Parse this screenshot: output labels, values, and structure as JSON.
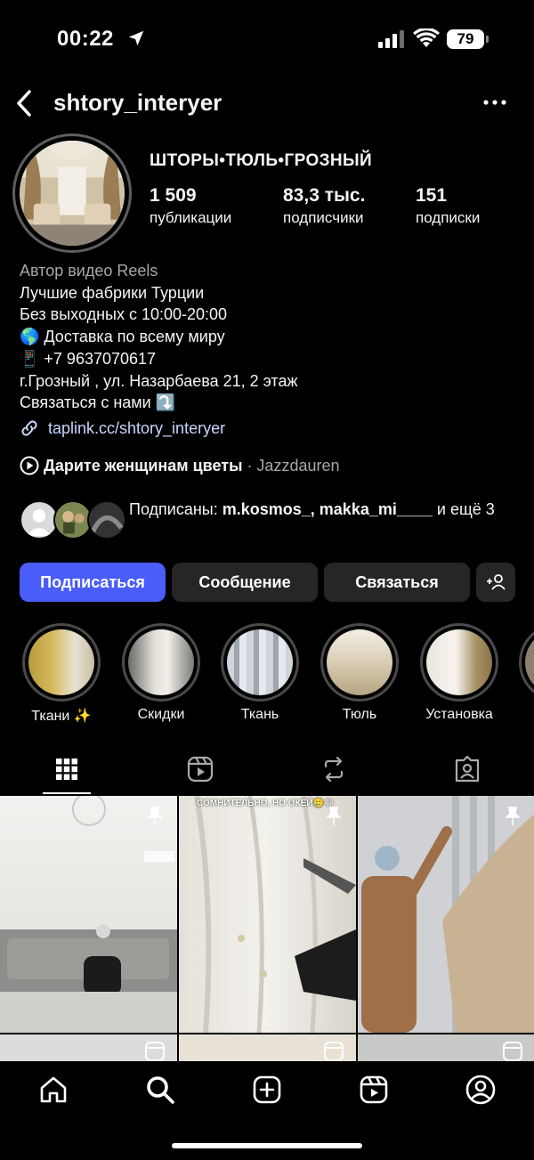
{
  "status_bar": {
    "time": "00:22",
    "battery": "79"
  },
  "header": {
    "username": "shtory_interyer"
  },
  "profile": {
    "name": "ШТОРЫ•ТЮЛЬ•ГРОЗНЫЙ",
    "stats": [
      {
        "value": "1 509",
        "label": "публикации"
      },
      {
        "value": "83,3 тыс.",
        "label": "подписчики"
      },
      {
        "value": "151",
        "label": "подписки"
      }
    ]
  },
  "bio": {
    "category": "Автор видео Reels",
    "lines": [
      "Лучшие фабрики Турции",
      "Без выходных с 10:00-20:00",
      "🌎 Доставка по всему миру",
      "📱 +7 9637070617",
      "г.Грозный , ул. Назарбаева 21, 2 этаж",
      "Связаться с нами ⤵️"
    ],
    "link": "taplink.cc/shtory_interyer",
    "reel_title": "Дарите женщинам цветы",
    "reel_author": "· Jazzdauren"
  },
  "followers": {
    "prefix": "Подписаны: ",
    "names": "m.kosmos_, makka_mi____",
    "suffix": " и ещё 3"
  },
  "buttons": {
    "follow": "Подписаться",
    "message": "Сообщение",
    "contact": "Связаться"
  },
  "highlights": [
    {
      "label": "Ткани ✨"
    },
    {
      "label": "Скидки"
    },
    {
      "label": "Ткань"
    },
    {
      "label": "Тюль"
    },
    {
      "label": "Установка"
    }
  ],
  "grid": {
    "caption_2": "СОМНИТЕЛЬНО, НО ОКЕЙ🥲😂"
  },
  "colors": {
    "accent": "#4a5df9",
    "background": "#000000",
    "button": "#262626",
    "link": "#c8d6ff"
  },
  "icons": {
    "nav": [
      "home-icon",
      "search-icon",
      "create-icon",
      "reels-icon",
      "profile-icon"
    ],
    "tabs": [
      "grid-icon",
      "reels-tab-icon",
      "reposts-icon",
      "tagged-icon"
    ]
  }
}
